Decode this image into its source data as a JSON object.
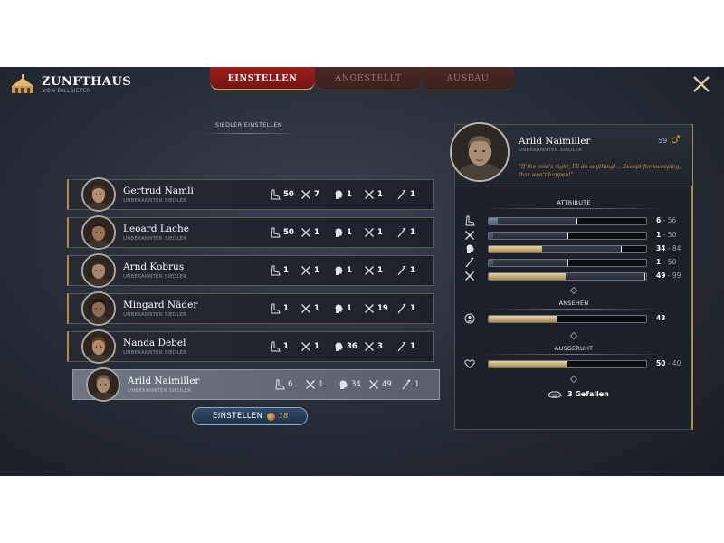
{
  "header": {
    "title": "ZUNFTHAUS",
    "subtitle": "VON DILLSIEPEN",
    "tabs": [
      {
        "label": "EINSTELLEN",
        "active": true
      },
      {
        "label": "ANGESTELLT",
        "active": false
      },
      {
        "label": "AUSBAU",
        "active": false
      }
    ]
  },
  "candidates": {
    "section_title": "SIEDLER EINSTELLEN",
    "rows": [
      {
        "name": "Gertrud Namli",
        "type": "UNBEKANNTER SIEDLER",
        "stats": [
          "50",
          "7",
          "1",
          "1",
          "1"
        ]
      },
      {
        "name": "Leoard Lache",
        "type": "UNBEKANNTER SIEDLER",
        "stats": [
          "50",
          "1",
          "1",
          "1",
          "1"
        ]
      },
      {
        "name": "Arnd Kobrus",
        "type": "UNBEKANNTER SIEDLER",
        "stats": [
          "1",
          "1",
          "1",
          "1",
          "1"
        ]
      },
      {
        "name": "Mingard Näder",
        "type": "UNBEKANNTER SIEDLER",
        "stats": [
          "1",
          "1",
          "1",
          "19",
          "1"
        ]
      },
      {
        "name": "Nanda Debel",
        "type": "UNBEKANNTER SIEDLER",
        "stats": [
          "1",
          "1",
          "36",
          "3",
          "1"
        ]
      },
      {
        "name": "Arild Naimiller",
        "type": "UNBEKANNTER SIEDLER",
        "stats": [
          "6",
          "1",
          "34",
          "49",
          "1"
        ]
      }
    ],
    "hire_button": {
      "label": "EINSTELLEN",
      "cost": "18"
    }
  },
  "detail": {
    "name": "Arild Naimiller",
    "type": "UNBEKANNTER SIEDLER",
    "age": "59",
    "gender_symbol": "♂",
    "quote": "\"If the coin's right, I'll do anything! .. Except for sweeping, that won't happen!\"",
    "attributes_title": "ATTRIBUTE",
    "attributes": [
      {
        "icon": "boot-icon",
        "value": "6",
        "range": " - 56",
        "fill": 0.06,
        "range_end": 0.56,
        "style": "blue"
      },
      {
        "icon": "crossed-swords-icon",
        "value": "1",
        "range": " - 50",
        "fill": 0.01,
        "range_end": 0.5,
        "style": "grey"
      },
      {
        "icon": "head-icon",
        "value": "34",
        "range": " - 84",
        "fill": 0.34,
        "range_end": 0.84,
        "style": "gold"
      },
      {
        "icon": "quill-icon",
        "value": "1",
        "range": " - 50",
        "fill": 0.01,
        "range_end": 0.5,
        "style": "grey"
      },
      {
        "icon": "crossed-swords-icon",
        "value": "49",
        "range": " - 99",
        "fill": 0.49,
        "range_end": 0.99,
        "style": "gold"
      }
    ],
    "reputation_title": "ANSEHEN",
    "reputation": {
      "value": "43",
      "fill": 0.43
    },
    "rested_title": "AUSGERUHT",
    "rested": {
      "value": "50",
      "range": " - 40",
      "fill": 0.5
    },
    "likes": "3 Gefallen"
  }
}
